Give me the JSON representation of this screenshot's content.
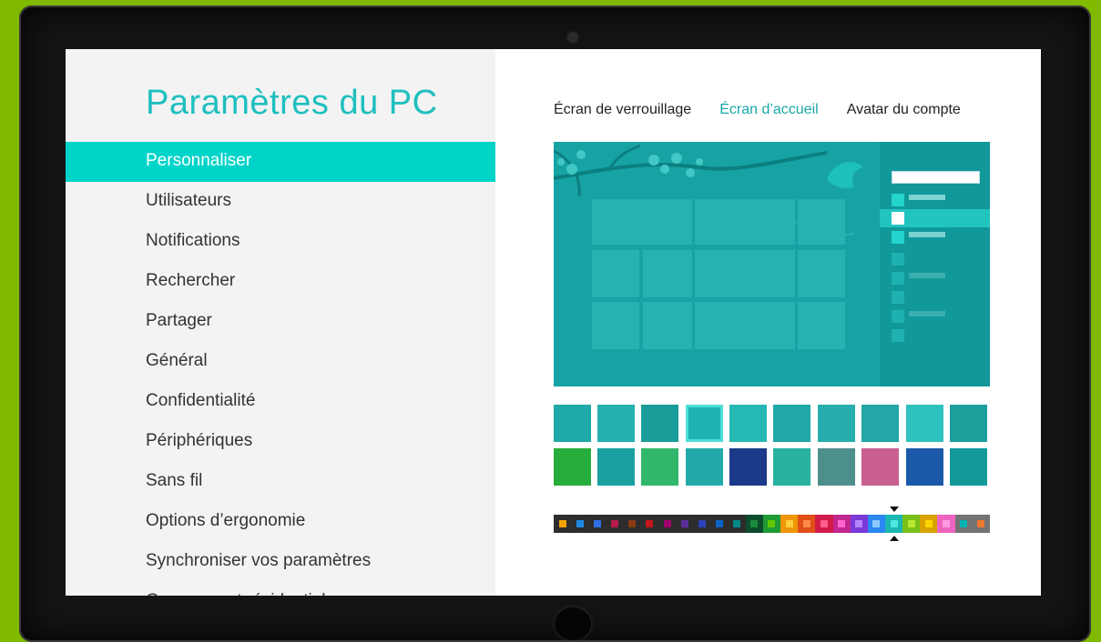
{
  "title": "Paramètres du PC",
  "nav": [
    {
      "label": "Personnaliser",
      "active": true
    },
    {
      "label": "Utilisateurs"
    },
    {
      "label": "Notifications"
    },
    {
      "label": "Rechercher"
    },
    {
      "label": "Partager"
    },
    {
      "label": "Général"
    },
    {
      "label": "Confidentialité"
    },
    {
      "label": "Périphériques"
    },
    {
      "label": "Sans fil"
    },
    {
      "label": "Options d’ergonomie"
    },
    {
      "label": "Synchroniser vos paramètres"
    },
    {
      "label": "Groupement résidentiel"
    }
  ],
  "tabs": [
    {
      "label": "Écran de verrouillage"
    },
    {
      "label": "Écran d’accueil",
      "active": true
    },
    {
      "label": "Avatar du compte"
    }
  ],
  "colors": {
    "accent": "#00d4c8",
    "preview_bg": "#17a3a4",
    "frame_green": "#7fba00"
  },
  "selected_pattern_index": 3,
  "selected_color_index": 19,
  "palette": [
    {
      "bg": "#2d2d2d",
      "dot": "#f4a100"
    },
    {
      "bg": "#2d2d2d",
      "dot": "#1e88e5"
    },
    {
      "bg": "#2d2d2d",
      "dot": "#2f6fe4"
    },
    {
      "bg": "#2d2d2d",
      "dot": "#b71c4a"
    },
    {
      "bg": "#2d2d2d",
      "dot": "#8a3b12"
    },
    {
      "bg": "#2d2d2d",
      "dot": "#c4161c"
    },
    {
      "bg": "#2d2d2d",
      "dot": "#a1006b"
    },
    {
      "bg": "#2d2d2d",
      "dot": "#5b2c9a"
    },
    {
      "bg": "#2d2d2d",
      "dot": "#2a43b8"
    },
    {
      "bg": "#2d2d2d",
      "dot": "#0a63c7"
    },
    {
      "bg": "#2d2d2d",
      "dot": "#008a8a"
    },
    {
      "bg": "#0b4d2d",
      "dot": "#1b8b3c"
    },
    {
      "bg": "#1f9a35",
      "dot": "#64c800"
    },
    {
      "bg": "#f09609",
      "dot": "#ffcf3d"
    },
    {
      "bg": "#e04f17",
      "dot": "#ff8a4c"
    },
    {
      "bg": "#d11a48",
      "dot": "#ff5c8d"
    },
    {
      "bg": "#c1278e",
      "dot": "#ff64d0"
    },
    {
      "bg": "#7a39d8",
      "dot": "#b585ff"
    },
    {
      "bg": "#2b87f1",
      "dot": "#8cc9ff"
    },
    {
      "bg": "#1bb7b2",
      "dot": "#4fe6df"
    },
    {
      "bg": "#79bf1a",
      "dot": "#b9e631"
    },
    {
      "bg": "#d9a300",
      "dot": "#ffd400"
    },
    {
      "bg": "#ee64c0",
      "dot": "#ff9ae0"
    },
    {
      "bg": "#737373",
      "dot": "#00b2b0"
    },
    {
      "bg": "#737373",
      "dot": "#f07830"
    }
  ]
}
